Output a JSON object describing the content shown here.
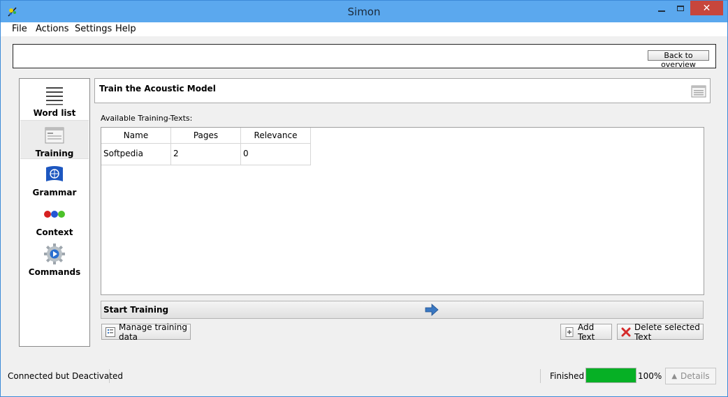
{
  "window": {
    "title": "Simon",
    "close_glyph": "✕"
  },
  "menu": {
    "file": "File",
    "actions": "Actions",
    "settings": "Settings",
    "help": "Help"
  },
  "overview": {
    "back_label": "Back to overview"
  },
  "sidebar": {
    "items": [
      {
        "label": "Word list",
        "icon": "list-icon"
      },
      {
        "label": "Training",
        "icon": "training-icon"
      },
      {
        "label": "Grammar",
        "icon": "grammar-flag-icon"
      },
      {
        "label": "Context",
        "icon": "context-dots-icon"
      },
      {
        "label": "Commands",
        "icon": "commands-gear-icon"
      }
    ],
    "active": "Training"
  },
  "panel": {
    "title": "Train the Acoustic Model",
    "available_label": "Available Training-Texts:",
    "table": {
      "columns": [
        "Name",
        "Pages",
        "Relevance"
      ],
      "rows": [
        [
          "Softpedia",
          "2",
          "0"
        ]
      ]
    },
    "start_training_label": "Start Training",
    "manage_label": "Manage training data",
    "add_text_label": "Add Text",
    "delete_label": "Delete selected Text"
  },
  "status": {
    "connection": "Connected but Deactivated",
    "finished_label": "Finished",
    "progress_percent": 100,
    "progress_text": "100%",
    "details_label": "Details",
    "details_glyph": "▲"
  },
  "colors": {
    "title_bar": "#5ba8ee",
    "close_button": "#c7463c",
    "progress_fill": "#06b025",
    "delete_icon": "#d42a2a",
    "arrow_icon": "#3a78c2"
  }
}
